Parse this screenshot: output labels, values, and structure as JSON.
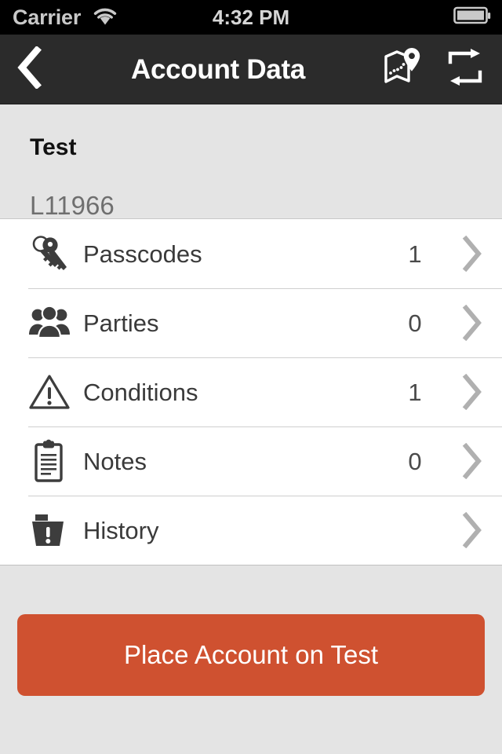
{
  "status_bar": {
    "carrier": "Carrier",
    "time": "4:32 PM",
    "wifi_icon": "wifi-icon",
    "battery_icon": "battery-full-icon"
  },
  "nav_bar": {
    "title": "Account Data",
    "back_icon": "chevron-left-icon",
    "map_icon": "map-pin-icon",
    "refresh_icon": "repeat-arrows-icon"
  },
  "account": {
    "name": "Test",
    "number": "L11966"
  },
  "list": {
    "rows": [
      {
        "icon": "keys-icon",
        "label": "Passcodes",
        "count": "1",
        "chevron": "chevron-right-icon"
      },
      {
        "icon": "people-group-icon",
        "label": "Parties",
        "count": "0",
        "chevron": "chevron-right-icon"
      },
      {
        "icon": "warning-triangle-icon",
        "label": "Conditions",
        "count": "1",
        "chevron": "chevron-right-icon"
      },
      {
        "icon": "clipboard-icon",
        "label": "Notes",
        "count": "0",
        "chevron": "chevron-right-icon"
      },
      {
        "icon": "folder-alert-icon",
        "label": "History",
        "count": "",
        "chevron": "chevron-right-icon"
      }
    ]
  },
  "footer": {
    "cta_label": "Place Account on Test"
  },
  "colors": {
    "status_bar_bg": "#000000",
    "nav_bar_bg": "#2b2b2b",
    "page_bg": "#e4e4e4",
    "list_bg": "#ffffff",
    "accent": "#cf5130",
    "icon": "#3d3d3d",
    "chevron": "#b0b0b0"
  }
}
